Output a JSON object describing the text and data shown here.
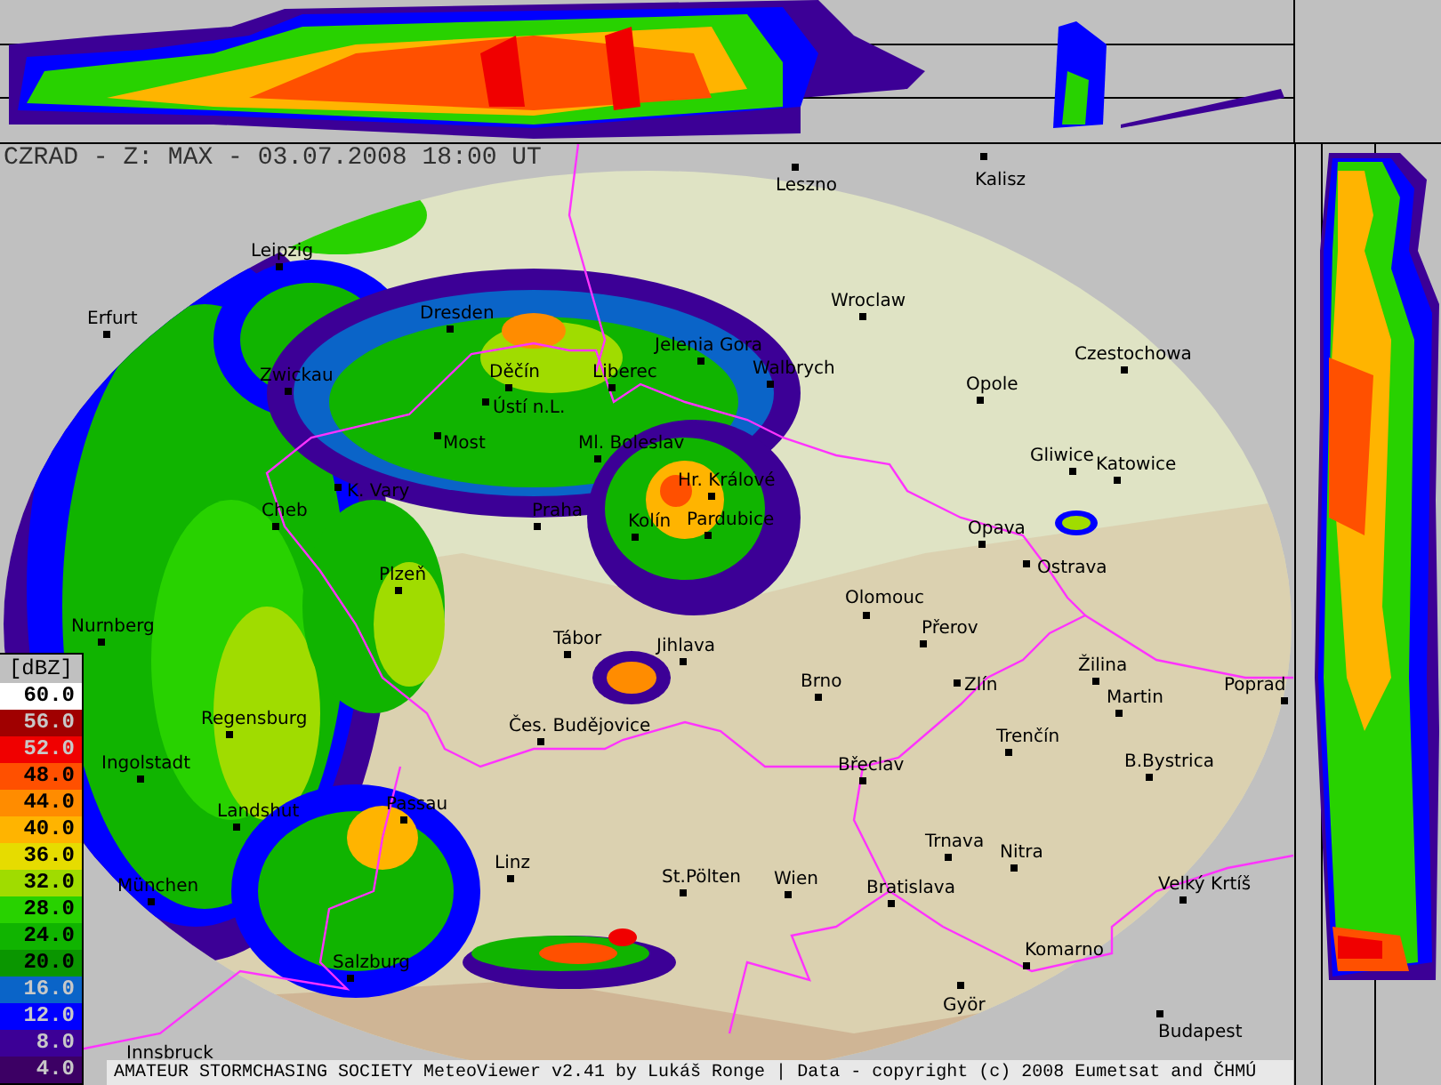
{
  "title": "CZRAD - Z: MAX - 03.07.2008 18:00 UT",
  "cities": [
    "Leszno",
    "Kalisz",
    "Leipzig",
    "Erfurt",
    "Wroclaw",
    "Dresden",
    "Jelenia Gora",
    "Czestochowa",
    "Zwickau",
    "Děčín",
    "Liberec",
    "Walbrych",
    "Opole",
    "Ústí n.L.",
    "Most",
    "Ml. Boleslav",
    "Gliwice",
    "Katowice",
    "K. Vary",
    "Hr. Králové",
    "Praha",
    "Cheb",
    "Kolín",
    "Pardubice",
    "Opava",
    "Ostrava",
    "Plzeň",
    "Olomouc",
    "Nurnberg",
    "Přerov",
    "Tábor",
    "Jihlava",
    "Brno",
    "Zlín",
    "Žilina",
    "Poprad",
    "Martin",
    "Regensburg",
    "Čes. Budějovice",
    "Trenčín",
    "Ingolstadt",
    "Břeclav",
    "B.Bystrica",
    "Passau",
    "Landshut",
    "Trnava",
    "Nitra",
    "Linz",
    "München",
    "St.Pölten",
    "Wien",
    "Bratislava",
    "Velký Krtíš",
    "Komarno",
    "Salzburg",
    "Györ",
    "Budapest",
    "Innsbruck"
  ],
  "legend": {
    "unit": "[dBZ]",
    "levels": [
      {
        "label": "60.0",
        "color": "#ffffff"
      },
      {
        "label": "56.0",
        "color": "#a00000"
      },
      {
        "label": "52.0",
        "color": "#f00000"
      },
      {
        "label": "48.0",
        "color": "#ff5000"
      },
      {
        "label": "44.0",
        "color": "#ff8c00"
      },
      {
        "label": "40.0",
        "color": "#ffb400"
      },
      {
        "label": "36.0",
        "color": "#e6dc00"
      },
      {
        "label": "32.0",
        "color": "#a0dc00"
      },
      {
        "label": "28.0",
        "color": "#28d200"
      },
      {
        "label": "24.0",
        "color": "#10b400"
      },
      {
        "label": "20.0",
        "color": "#0a9600"
      },
      {
        "label": "16.0",
        "color": "#0a64c8"
      },
      {
        "label": "12.0",
        "color": "#0000ff"
      },
      {
        "label": "8.0",
        "color": "#3c0096"
      },
      {
        "label": "4.0",
        "color": "#3c0064"
      }
    ]
  },
  "footer": "AMATEUR STORMCHASING SOCIETY MeteoViewer v2.41 by Lukáš Ronge | Data - copyright (c) 2008 Eumetsat and ČHMÚ"
}
